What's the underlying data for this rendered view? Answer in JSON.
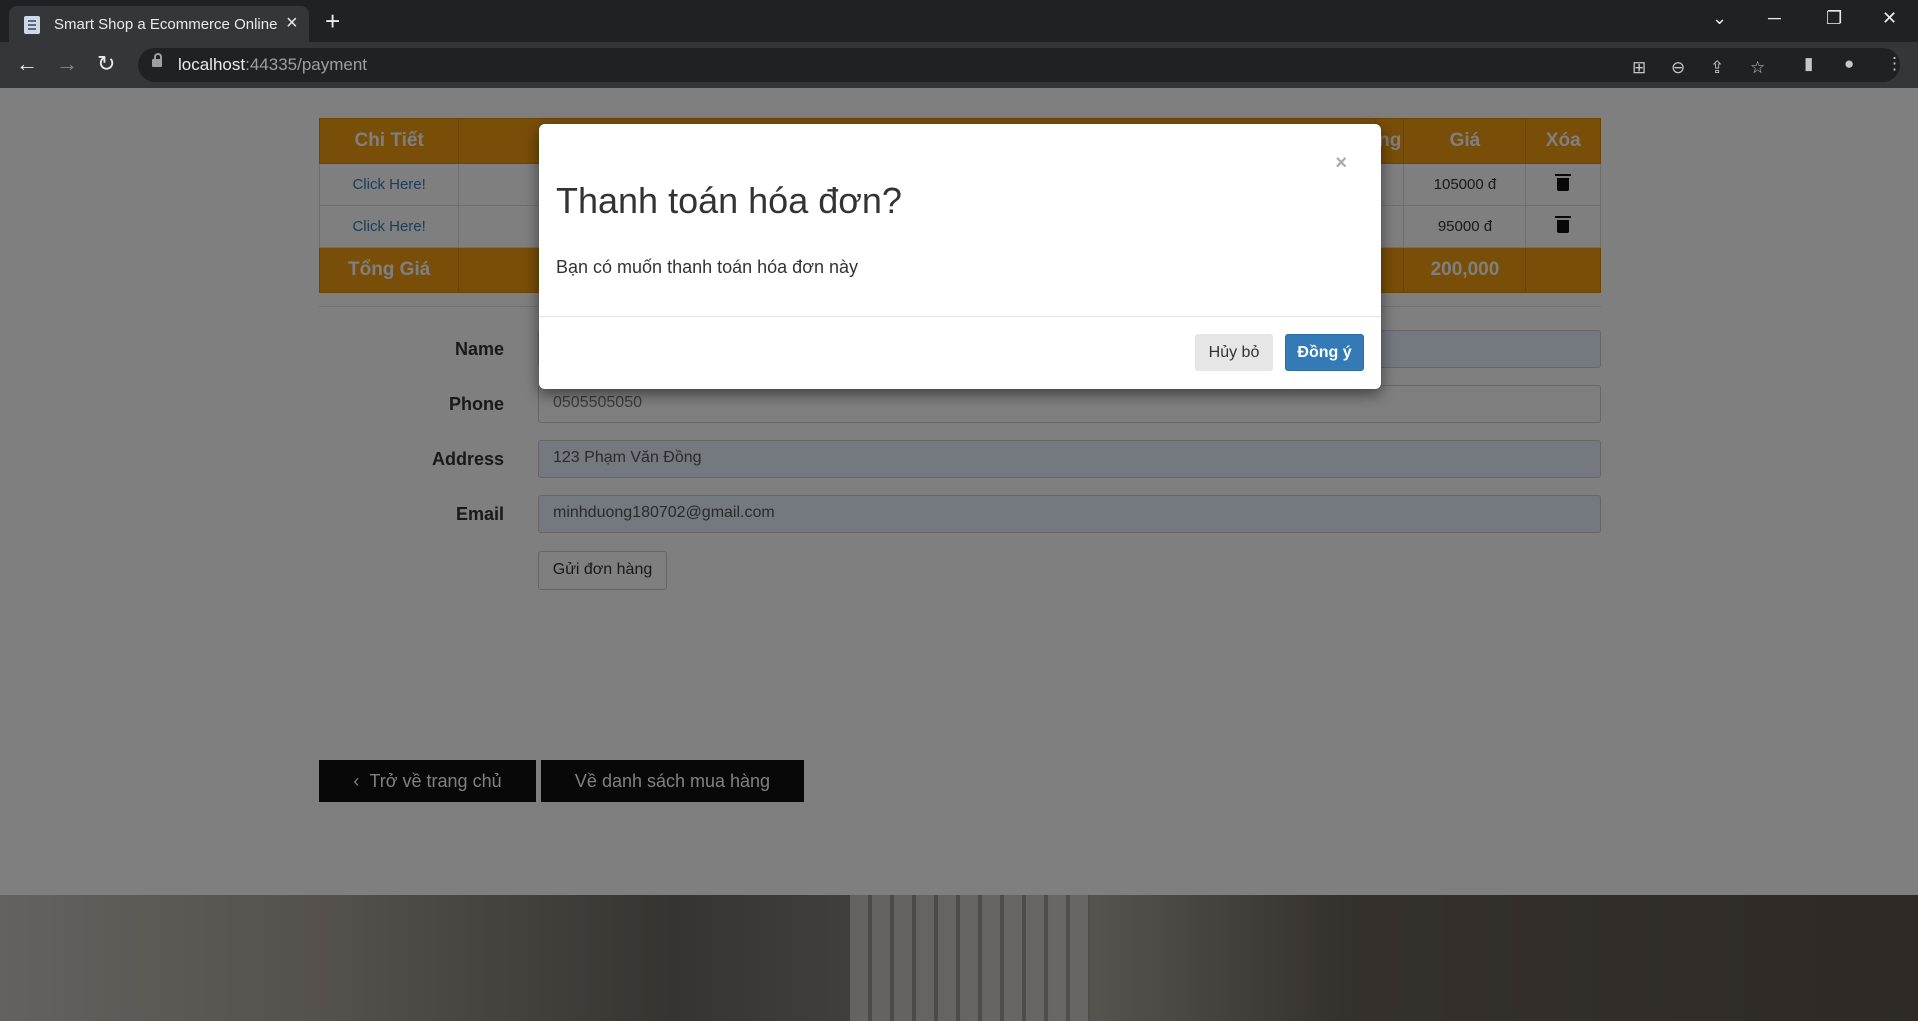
{
  "browser": {
    "tab_title": "Smart Shop a Ecommerce Online",
    "url_host": "localhost",
    "url_rest": ":44335/payment"
  },
  "cart": {
    "headers": [
      "Chi Tiết",
      "",
      "ng",
      "Giá",
      "Xóa"
    ],
    "rows": [
      {
        "link": "Click Here!",
        "price": "105000 đ"
      },
      {
        "link": "Click Here!",
        "price": "95000 đ"
      }
    ],
    "total_label": "Tổng Giá",
    "total_value": "200,000"
  },
  "form": {
    "name_label": "Name",
    "phone_label": "Phone",
    "phone_value": "0505505050",
    "address_label": "Address",
    "address_value": "123 Phạm Văn Đồng",
    "email_label": "Email",
    "email_value": "minhduong180702@gmail.com",
    "submit_label": "Gửi đơn hàng"
  },
  "nav_buttons": {
    "home": "Trở về trang chủ",
    "list": "Về danh sách mua hàng"
  },
  "modal": {
    "title": "Thanh toán hóa đơn?",
    "body": "Bạn có muốn thanh toán hóa đơn này",
    "cancel": "Hủy bỏ",
    "confirm": "Đồng ý",
    "close": "×"
  }
}
